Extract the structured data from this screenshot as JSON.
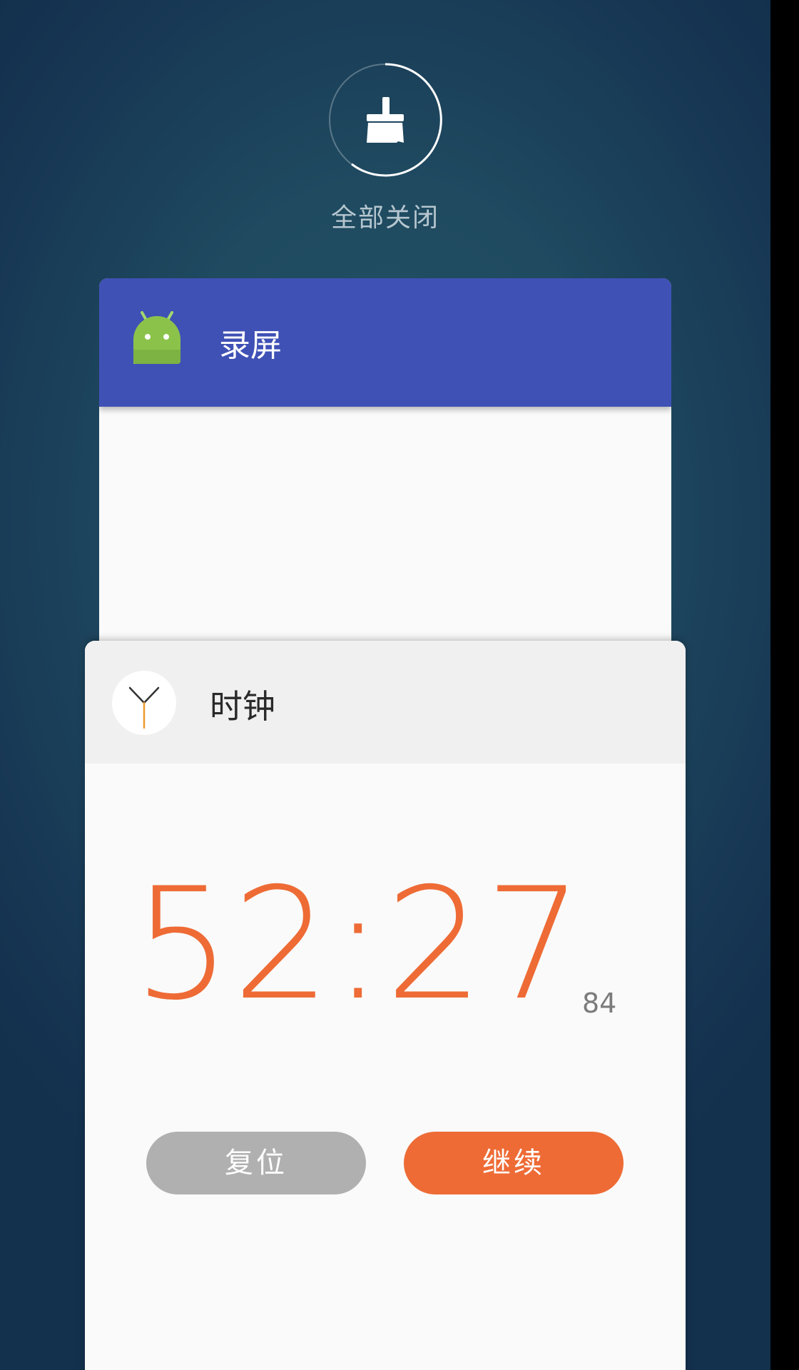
{
  "close_all": {
    "label": "全部关闭",
    "icon": "broom-icon",
    "ring_color": "#ffffff"
  },
  "cards": {
    "recorder": {
      "app_name": "录屏",
      "icon": "android-icon",
      "header_color": "#3f51b5"
    },
    "clock": {
      "app_name": "时钟",
      "icon": "clock-icon",
      "header_color": "#f0f0f0",
      "stopwatch": {
        "time": "52:27",
        "hundredths": "84"
      },
      "buttons": {
        "reset_label": "复位",
        "resume_label": "继续"
      }
    }
  },
  "colors": {
    "accent": "#ee6b36",
    "reset_button": "#b0b0b0",
    "android_green": "#8bc34a"
  }
}
